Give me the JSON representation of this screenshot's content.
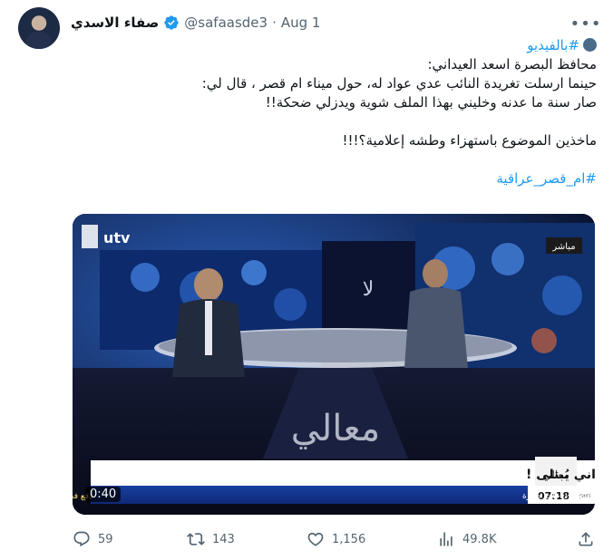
{
  "author": {
    "display_name": "صفاء الاسدي",
    "handle": "@safaasde3",
    "separator": "·",
    "date": "Aug 1",
    "verified": true,
    "avatar_icon": "profile-photo"
  },
  "more_icon": "more-dots-icon",
  "tweet": {
    "hashtag_video": "#بالفيديو",
    "line1": "محافظ البصرة اسعد العيداني:",
    "line2": "حينما ارسلت تغريدة النائب عدي عواد له، حول ميناء ام قصر ، قال لي:",
    "line3": "صار سنة ما عدنه وخليني بهذا الملف شوية ويدزلي ضحكة!!",
    "line4": "ماخذين الموضوع باستهزاء وطشه إعلامية؟!!!",
    "hashtag_end": "#ام_قصر_عراقية"
  },
  "video": {
    "duration": "0:40",
    "channel_logo": "utv",
    "live_badge": "مباشر",
    "program_logo": "معالي",
    "headline": "صدام يتنازل والعيداني يُبتلى !",
    "ticker": "7 محافظات عراقية تتخطى حاجز 50 مئوية والبصرة وميسان والناصرية والمثنى تسجل درجات حرارة",
    "ticker_left": "دفع فدية مالية",
    "clock": "07:18",
    "clock_zone": "GMT"
  },
  "actions": {
    "replies": "59",
    "retweets": "143",
    "likes": "1,156",
    "views": "49.8K"
  },
  "colors": {
    "accent": "#1d9bf0",
    "muted": "#536471",
    "text": "#0f1419"
  }
}
